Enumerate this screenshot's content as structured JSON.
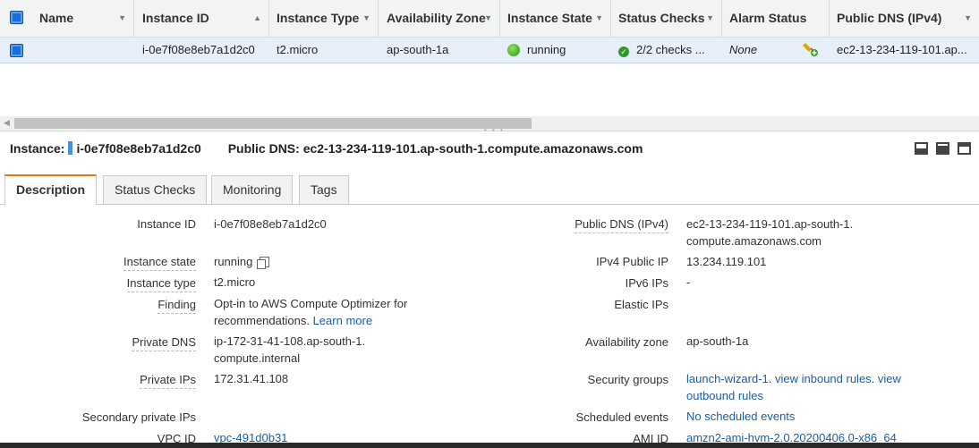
{
  "table": {
    "columns": [
      {
        "label": "Name",
        "sort": "▼"
      },
      {
        "label": "Instance ID",
        "sort": "▲"
      },
      {
        "label": "Instance Type",
        "sort": "▼"
      },
      {
        "label": "Availability Zone",
        "sort": "▼"
      },
      {
        "label": "Instance State",
        "sort": "▼"
      },
      {
        "label": "Status Checks",
        "sort": "▼"
      },
      {
        "label": "Alarm Status",
        "sort": ""
      },
      {
        "label": "Public DNS (IPv4)",
        "sort": "▼"
      }
    ],
    "row": {
      "instance_id": "i-0e7f08e8eb7a1d2c0",
      "instance_type": "t2.micro",
      "availability_zone": "ap-south-1a",
      "instance_state": "running",
      "status_checks": "2/2 checks ...",
      "alarm_status": "None",
      "public_dns": "ec2-13-234-119-101.ap..."
    }
  },
  "detail": {
    "instance_label": "Instance:",
    "instance_id": "i-0e7f08e8eb7a1d2c0",
    "public_dns_label": "Public DNS:",
    "public_dns": "ec2-13-234-119-101.ap-south-1.compute.amazonaws.com"
  },
  "tabs": [
    "Description",
    "Status Checks",
    "Monitoring",
    "Tags"
  ],
  "left_fields": {
    "instance_id": {
      "label": "Instance ID",
      "value": "i-0e7f08e8eb7a1d2c0"
    },
    "instance_state": {
      "label": "Instance state",
      "value": "running"
    },
    "instance_type": {
      "label": "Instance type",
      "value": "t2.micro"
    },
    "finding": {
      "label": "Finding",
      "value": "Opt-in to AWS Compute Optimizer for recommendations.",
      "link": "Learn more"
    },
    "private_dns": {
      "label": "Private DNS",
      "value": "ip-172-31-41-108.ap-south-1.compute.internal"
    },
    "private_ips": {
      "label": "Private IPs",
      "value": "172.31.41.108"
    },
    "secondary_private_ips": {
      "label": "Secondary private IPs",
      "value": ""
    },
    "vpc_id": {
      "label": "VPC ID",
      "value": "vpc-491d0b31"
    }
  },
  "right_fields": {
    "public_dns": {
      "label": "Public DNS (IPv4)",
      "value": "ec2-13-234-119-101.ap-south-1.compute.amazonaws.com"
    },
    "ipv4_public_ip": {
      "label": "IPv4 Public IP",
      "value": "13.234.119.101"
    },
    "ipv6_ips": {
      "label": "IPv6 IPs",
      "value": "-"
    },
    "elastic_ips": {
      "label": "Elastic IPs",
      "value": ""
    },
    "availability_zone": {
      "label": "Availability zone",
      "value": "ap-south-1a"
    },
    "security_groups": {
      "label": "Security groups",
      "link1": "launch-wizard-1",
      "link2": "view inbound rules",
      "link3": "view outbound rules"
    },
    "scheduled_events": {
      "label": "Scheduled events",
      "value": "No scheduled events"
    },
    "ami_id": {
      "label": "AMI ID",
      "value": "amzn2-ami-hvm-2.0.20200406.0-x86_64"
    }
  },
  "colors": {
    "accent_tab": "#e47911",
    "link": "#1a5ea8",
    "row_selected": "#e6effa",
    "running": "#2b9a14"
  },
  "icons": [
    "checkbox-icon",
    "sort-caret-icon",
    "running-status-icon",
    "check-circle-icon",
    "alarm-bell-icon",
    "copy-icon",
    "panel-layout-icon"
  ]
}
